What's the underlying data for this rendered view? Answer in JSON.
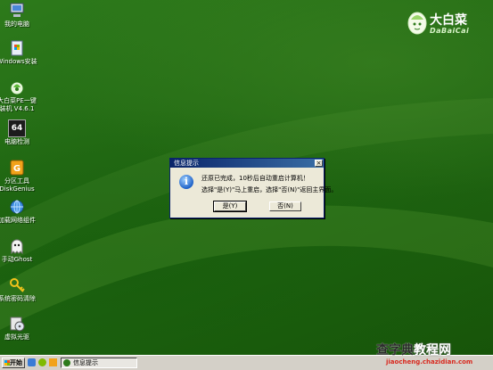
{
  "desktop": {
    "icons": [
      {
        "label": "我的电脑",
        "icon": "my-computer-icon"
      },
      {
        "label": "Windows安装",
        "icon": "windows-install-icon"
      },
      {
        "label": "大白菜PE一键",
        "label2": "装机 V4.6.1",
        "icon": "dabaicai-installer-icon"
      },
      {
        "label": "电脑检测",
        "icon": "pc-check-icon"
      },
      {
        "label": "分区工具",
        "label2": "DiskGenius",
        "icon": "diskgenius-icon"
      },
      {
        "label": "加载网络组件",
        "icon": "network-icon"
      },
      {
        "label": "手动Ghost",
        "icon": "ghost-icon"
      },
      {
        "label": "系统密码清除",
        "icon": "password-key-icon"
      },
      {
        "label": "虚拟光驱",
        "icon": "virtual-drive-icon"
      }
    ],
    "pc_check_badge": "64"
  },
  "logo": {
    "cn": "大白菜",
    "en": "DaBaiCai"
  },
  "dialog": {
    "title": "信息提示",
    "close_label": "×",
    "message1": "还原已完成，10秒后自动重启计算机！",
    "message2": "选择\"是(Y)\"马上重启，选择\"否(N)\"返回主界面。",
    "yes_label": "是(Y)",
    "no_label": "否(N)",
    "info_glyph": "i"
  },
  "taskbar": {
    "start_label": "开始",
    "task_label": "信息提示"
  },
  "watermark": {
    "line1_a": "查字典",
    "line1_b": "教程网",
    "line2": "jiaocheng.chazidian.com"
  },
  "colors": {
    "desktop": "#236b14",
    "titlebar": "#0a246a",
    "dialog_bg": "#ece9d8",
    "taskbar": "#d4d0c8"
  }
}
